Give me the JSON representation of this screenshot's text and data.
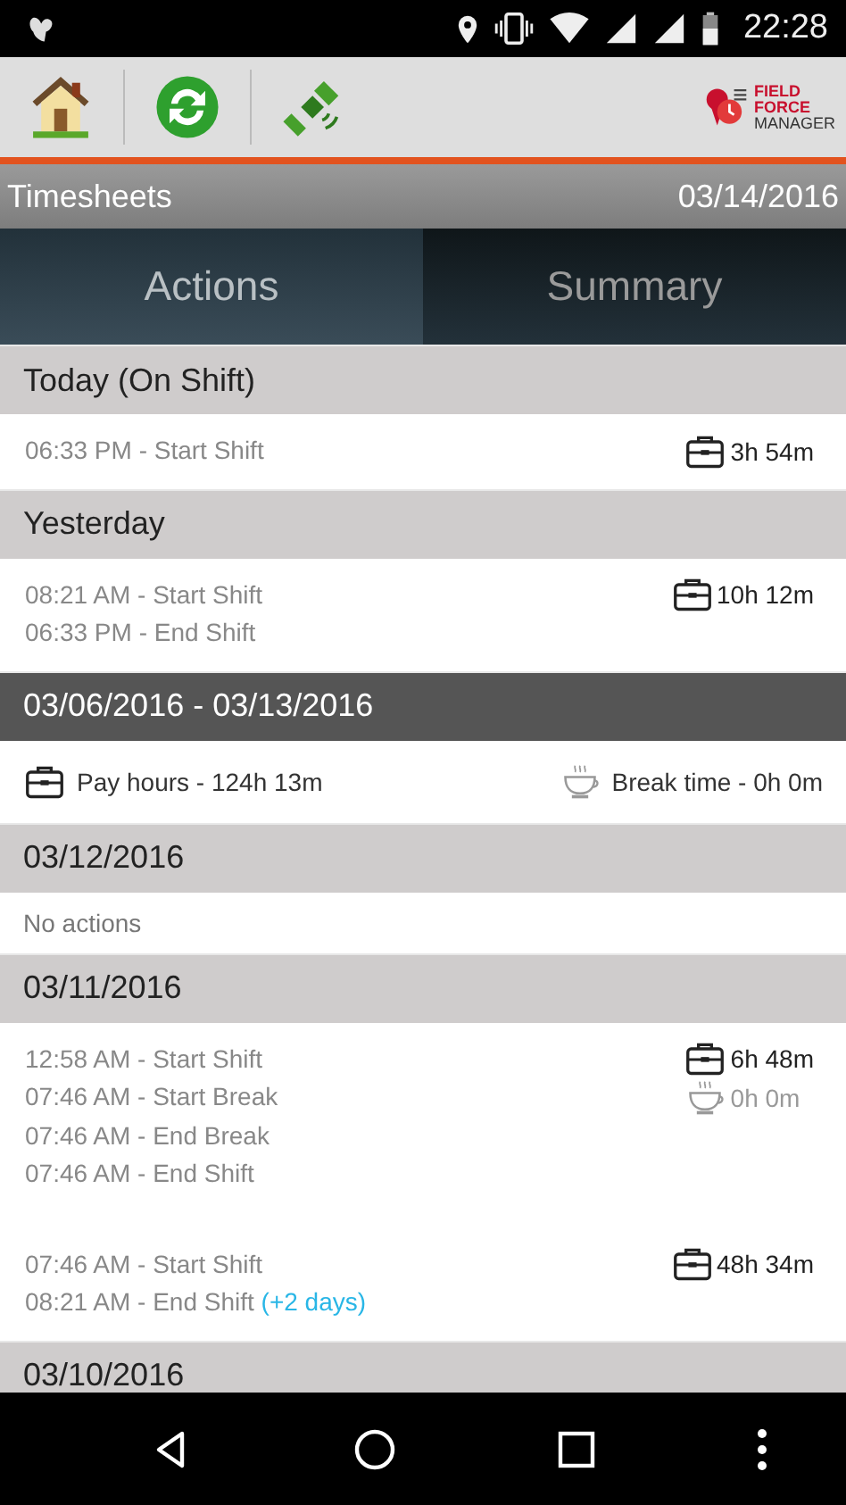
{
  "status_bar": {
    "time": "22:28"
  },
  "toolbar": {
    "buttons": [
      {
        "kind": "home"
      },
      {
        "kind": "sync"
      },
      {
        "kind": "satellite"
      }
    ],
    "logo": [
      "FIELD",
      "FORCE",
      "MANAGER"
    ]
  },
  "title_bar": {
    "title": "Timesheets",
    "date": "03/14/2016"
  },
  "tabs": [
    {
      "label": "Actions",
      "selected": true
    },
    {
      "label": "Summary",
      "selected": false
    }
  ],
  "sections": [
    {
      "kind": "day",
      "title": "Today (On Shift)",
      "groups": [
        {
          "lines": [
            {
              "text": "06:33 PM - Start Shift"
            }
          ],
          "durations": [
            {
              "kind": "work",
              "text": "3h 54m",
              "disabled": false
            }
          ]
        }
      ]
    },
    {
      "kind": "day",
      "title": "Yesterday",
      "groups": [
        {
          "lines": [
            {
              "text": "08:21 AM - Start Shift"
            },
            {
              "text": "06:33 PM - End Shift"
            }
          ],
          "durations": [
            {
              "kind": "work",
              "text": "10h 12m",
              "disabled": false
            }
          ]
        }
      ]
    },
    {
      "kind": "range",
      "title": "03/06/2016 - 03/13/2016",
      "totals": [
        {
          "kind": "work",
          "text": "Pay hours - 124h 13m"
        },
        {
          "kind": "break",
          "text": "Break time - 0h 0m"
        }
      ]
    },
    {
      "kind": "day",
      "title": "03/12/2016",
      "empty": "No actions"
    },
    {
      "kind": "day",
      "title": "03/11/2016",
      "groups": [
        {
          "lines": [
            {
              "text": "12:58 AM - Start Shift"
            },
            {
              "text": "07:46 AM - Start Break"
            },
            {
              "text": "07:46 AM - End Break"
            },
            {
              "text": "07:46 AM - End Shift"
            }
          ],
          "durations": [
            {
              "kind": "work",
              "text": "6h 48m",
              "disabled": false
            },
            {
              "kind": "break",
              "text": "0h 0m",
              "disabled": true
            }
          ]
        },
        {
          "lines": [
            {
              "text": "07:46 AM - Start Shift"
            },
            {
              "text": "08:21 AM - End Shift",
              "note": "(+2 days)"
            }
          ],
          "durations": [
            {
              "kind": "work",
              "text": "48h 34m",
              "disabled": false
            }
          ]
        }
      ]
    },
    {
      "kind": "day",
      "title": "03/10/2016"
    }
  ]
}
